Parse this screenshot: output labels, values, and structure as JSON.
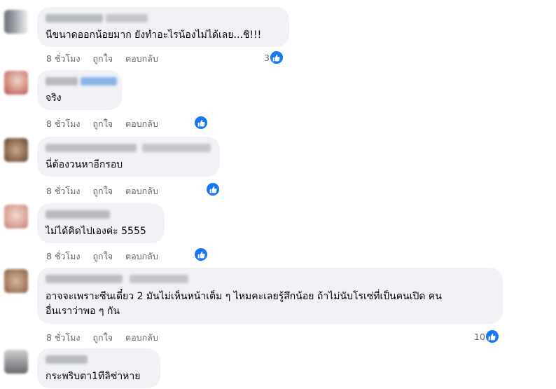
{
  "colors": {
    "bubble": "#f0f2f5",
    "text": "#050505",
    "meta": "#65676b",
    "like": "#1877f2"
  },
  "comments": [
    {
      "text": "นีขนาดออกน้อยมาก ยังทำอะไรน้องไม่ได้เลย...ชิ!!!",
      "time": "8 ชั่วโมง",
      "like_label": "ถูกใจ",
      "reply_label": "ตอบกลับ",
      "reaction_count": "3"
    },
    {
      "text": "จริง",
      "time": "8 ชั่วโมง",
      "like_label": "ถูกใจ",
      "reply_label": "ตอบกลับ",
      "reaction_count": ""
    },
    {
      "text": "นี่ต้องวนหาอีกรอบ",
      "time": "8 ชั่วโมง",
      "like_label": "ถูกใจ",
      "reply_label": "ตอบกลับ",
      "reaction_count": ""
    },
    {
      "text": "ไม่ได้คิดไปเองค่ะ 5555",
      "time": "8 ชั่วโมง",
      "like_label": "ถูกใจ",
      "reply_label": "ตอบกลับ",
      "reaction_count": ""
    },
    {
      "text": "อาจจะเพราะซีนเดี๋ยว 2 มันไม่เห็นหน้าเต็ม ๆ ไหมคะเลยรู้สึกน้อย ถ้าไม่นับโรเซ่ที่เป็นคนเปิด คน\nอื่นเราว่าพอ ๆ กัน",
      "time": "8 ชั่วโมง",
      "like_label": "ถูกใจ",
      "reply_label": "ตอบกลับ",
      "reaction_count": "10"
    },
    {
      "text": "กระพริบตา1ทีลิซ่าหาย",
      "time": "",
      "like_label": "",
      "reply_label": "",
      "reaction_count": ""
    }
  ]
}
